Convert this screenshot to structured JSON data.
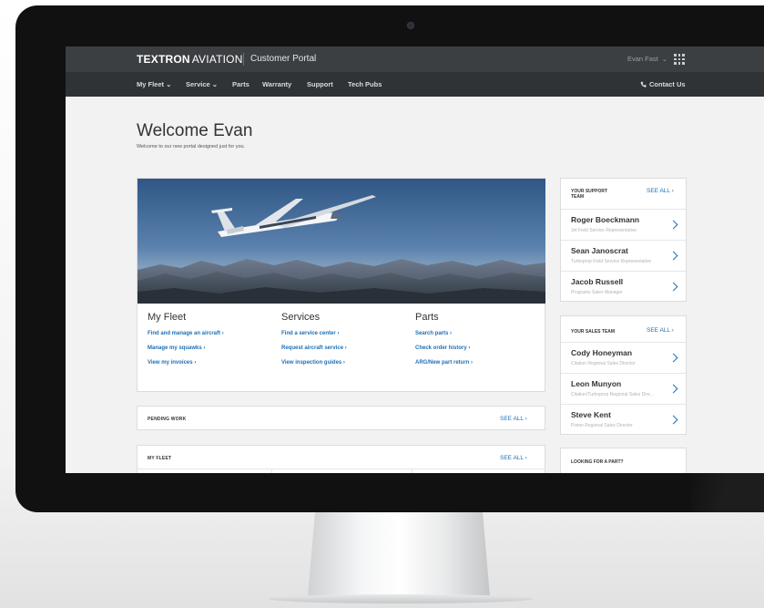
{
  "header": {
    "brand_bold": "TEXTRON",
    "brand_light": "AVIATION",
    "portal_title": "Customer Portal",
    "user_name": "Evan Fast",
    "user_chevron": "⌄",
    "apps_icon": "grid-icon"
  },
  "nav": {
    "items": [
      {
        "label": "My Fleet ⌄"
      },
      {
        "label": "Service ⌄"
      },
      {
        "label": "Parts"
      },
      {
        "label": "Warranty"
      },
      {
        "label": "Support"
      },
      {
        "label": "Tech Pubs"
      }
    ],
    "contact_label": "Contact Us",
    "contact_icon": "phone-icon"
  },
  "welcome": {
    "title": "Welcome Evan",
    "subtitle": "Welcome to our new portal designed just for you."
  },
  "feature": {
    "columns": [
      {
        "title": "My Fleet",
        "links": [
          "Find and manage an aircraft ›",
          "Manage my squawks ›",
          "View my invoices ›"
        ]
      },
      {
        "title": "Services",
        "links": [
          "Find a service center ›",
          "Request aircraft service ›",
          "View inspection guides ›"
        ]
      },
      {
        "title": "Parts",
        "links": [
          "Search parts ›",
          "Check order history ›",
          "ARG/New part return ›"
        ]
      }
    ]
  },
  "pending": {
    "label": "PENDING WORK",
    "see_all": "SEE ALL  ›"
  },
  "fleet": {
    "label": "MY FLEET",
    "see_all": "SEE ALL  ›"
  },
  "support_team": {
    "heading_line1": "YOUR SUPPORT",
    "heading_line2": "TEAM",
    "see_all": "SEE ALL ›",
    "people": [
      {
        "name": "Roger Boeckmann",
        "role": "Jet Field Service Representative"
      },
      {
        "name": "Sean Janoscrat",
        "role": "Turboprop Field Service Representative"
      },
      {
        "name": "Jacob Russell",
        "role": "Programs Sales Manager"
      }
    ]
  },
  "sales_team": {
    "heading": "YOUR SALES TEAM",
    "see_all": "SEE ALL ›",
    "people": [
      {
        "name": "Cody Honeyman",
        "role": "Citation Regional Sales Director"
      },
      {
        "name": "Leon Munyon",
        "role": "Citation/Turboprop Regional Sales Dire..."
      },
      {
        "name": "Steve Kent",
        "role": "Piston Regional Sales Director"
      }
    ]
  },
  "part_lookup": {
    "heading": "LOOKING FOR A PART?"
  },
  "colors": {
    "accent": "#1f6fb5",
    "topbar": "#3c3f42",
    "navbar": "#303336",
    "page_bg": "#f2f2f2"
  }
}
